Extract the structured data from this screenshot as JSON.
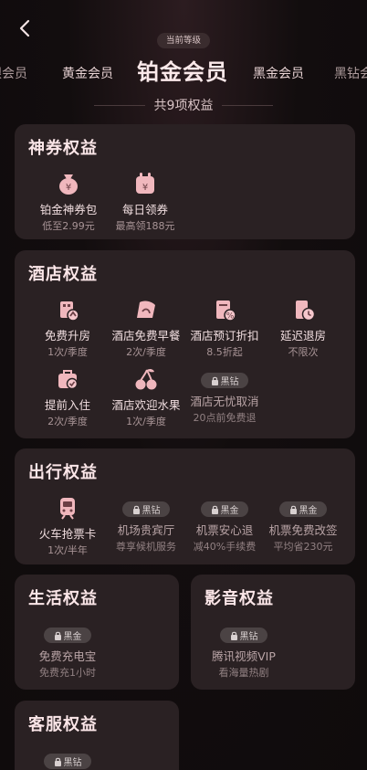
{
  "header": {
    "back_icon": "back-chevron-icon",
    "current_level_tag": "当前等级",
    "levels": [
      "银会员",
      "黄金会员",
      "铂金会员",
      "黑金会员",
      "黑钻会"
    ],
    "benefit_count": "共9项权益"
  },
  "sections": {
    "coupon": {
      "title": "神券权益",
      "items": [
        {
          "name": "铂金神券包",
          "sub": "低至2.99元",
          "icon": "money-bag-icon"
        },
        {
          "name": "每日领券",
          "sub": "最高领188元",
          "icon": "calendar-coupon-icon"
        }
      ]
    },
    "hotel": {
      "title": "酒店权益",
      "items": [
        {
          "name": "免费升房",
          "sub": "1次/季度",
          "icon": "room-upgrade-icon"
        },
        {
          "name": "酒店免费早餐",
          "sub": "2次/季度",
          "icon": "breakfast-icon"
        },
        {
          "name": "酒店预订折扣",
          "sub": "8.5折起",
          "icon": "discount-icon"
        },
        {
          "name": "延迟退房",
          "sub": "不限次",
          "icon": "late-checkout-icon"
        },
        {
          "name": "提前入住",
          "sub": "2次/季度",
          "icon": "early-checkin-icon"
        },
        {
          "name": "酒店欢迎水果",
          "sub": "1次/季度",
          "icon": "cherry-icon"
        },
        {
          "name": "酒店无忧取消",
          "sub": "20点前免费退",
          "badge": "黑钻"
        }
      ]
    },
    "travel": {
      "title": "出行权益",
      "items": [
        {
          "name": "火车抢票卡",
          "sub": "1次/半年",
          "icon": "train-icon"
        },
        {
          "name": "机场贵宾厅",
          "sub": "尊享候机服务",
          "badge": "黑钻"
        },
        {
          "name": "机票安心退",
          "sub": "减40%手续费",
          "badge": "黑金"
        },
        {
          "name": "机票免费改签",
          "sub": "平均省230元",
          "badge": "黑金"
        }
      ]
    },
    "life": {
      "title": "生活权益",
      "items": [
        {
          "name": "免费充电宝",
          "sub": "免费充1小时",
          "badge": "黑金"
        }
      ]
    },
    "media": {
      "title": "影音权益",
      "items": [
        {
          "name": "腾讯视频VIP",
          "sub": "看海量热剧",
          "badge": "黑钻"
        }
      ]
    },
    "service": {
      "title": "客服权益",
      "items": [
        {
          "badge": "黑钻"
        }
      ]
    }
  },
  "colors": {
    "background": "#0f0b0c",
    "card": "#2a2123",
    "icon_pink": "#f0b7bd",
    "badge_bg": "#4b4344"
  }
}
